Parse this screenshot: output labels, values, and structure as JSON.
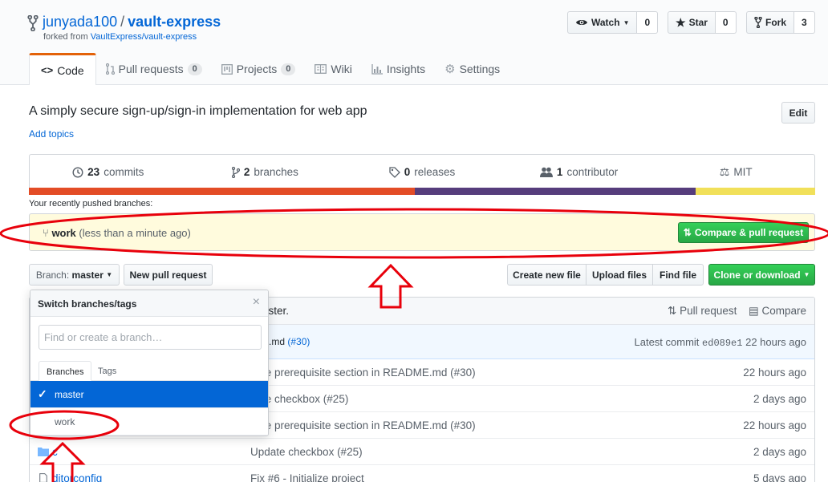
{
  "repo": {
    "owner": "junyada100",
    "separator": "/",
    "name": "vault-express",
    "forked_prefix": "forked from",
    "forked_link": "VaultExpress/vault-express"
  },
  "actions": {
    "watch_label": "Watch",
    "watch_count": "0",
    "star_label": "Star",
    "star_count": "0",
    "fork_label": "Fork",
    "fork_count": "3"
  },
  "tabs": [
    {
      "label": "Code",
      "icon": "code-icon"
    },
    {
      "label": "Pull requests",
      "count": "0",
      "icon": "pull-request-icon"
    },
    {
      "label": "Projects",
      "count": "0",
      "icon": "project-icon"
    },
    {
      "label": "Wiki",
      "icon": "book-icon"
    },
    {
      "label": "Insights",
      "icon": "graph-icon"
    },
    {
      "label": "Settings",
      "icon": "gear-icon"
    }
  ],
  "description": "A simply secure sign-up/sign-in implementation for web app",
  "add_topics": "Add topics",
  "edit_label": "Edit",
  "summary": {
    "commits_num": "23",
    "commits_label": "commits",
    "branches_num": "2",
    "branches_label": "branches",
    "releases_num": "0",
    "releases_label": "releases",
    "contributors_num": "1",
    "contributors_label": "contributor",
    "license": "MIT"
  },
  "lang_colors": [
    "#e34c26",
    "#563d7c",
    "#f1e05a"
  ],
  "lang_fractions": [
    0.491,
    0.357,
    0.152
  ],
  "recent_pushed_label": "Your recently pushed branches:",
  "pushed": {
    "branch": "work",
    "time": "(less than a minute ago)",
    "compare_label": "Compare & pull request"
  },
  "toolbar": {
    "branch_prefix": "Branch:",
    "branch_name": "master",
    "new_pr": "New pull request",
    "create_file": "Create new file",
    "upload": "Upload files",
    "find": "Find file",
    "clone": "Clone or download"
  },
  "file_header": {
    "text": "aster.",
    "pull_request": "Pull request",
    "compare": "Compare"
  },
  "latest_commit": {
    "msg": "E.md",
    "pr": "(#30)",
    "label": "Latest commit",
    "sha": "ed089e1",
    "time": "22 hours ago"
  },
  "files": [
    {
      "name": "",
      "msg": "date prerequisite section in README.md (#30)",
      "age": "22 hours ago"
    },
    {
      "name": "",
      "msg": "date checkbox (#25)",
      "age": "2 days ago"
    },
    {
      "name": "",
      "msg": "date prerequisite section in README.md (#30)",
      "age": "22 hours ago"
    },
    {
      "name": "c",
      "msg": "Update checkbox (#25)",
      "age": "2 days ago"
    },
    {
      "name": "ditorconfig",
      "msg": "Fix #6 - Initialize project",
      "age": "5 days ago"
    }
  ],
  "dropdown": {
    "title": "Switch branches/tags",
    "close": "×",
    "placeholder": "Find or create a branch…",
    "tab_branches": "Branches",
    "tab_tags": "Tags",
    "branches": [
      "master",
      "work"
    ]
  },
  "annotation_color": "#e8000b"
}
